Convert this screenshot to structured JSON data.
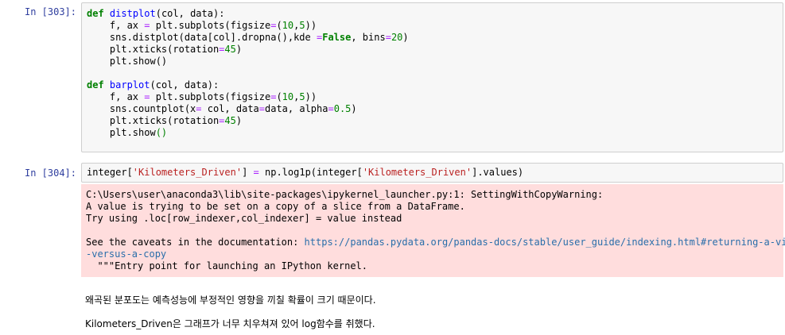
{
  "cell1": {
    "prompt": "In [303]:",
    "lines": [
      [
        [
          "kw",
          "def"
        ],
        [
          "t",
          " "
        ],
        [
          "fn",
          "distplot"
        ],
        [
          "t",
          "(col, data):"
        ]
      ],
      [
        [
          "t",
          "    f, ax "
        ],
        [
          "op",
          "="
        ],
        [
          "t",
          " plt.subplots(figsize"
        ],
        [
          "op",
          "="
        ],
        [
          "t",
          "("
        ],
        [
          "num",
          "10"
        ],
        [
          "t",
          ","
        ],
        [
          "num",
          "5"
        ],
        [
          "t",
          "))"
        ]
      ],
      [
        [
          "t",
          "    sns.distplot(data[col].dropna(),kde "
        ],
        [
          "op",
          "="
        ],
        [
          "kw",
          "False"
        ],
        [
          "t",
          ", bins"
        ],
        [
          "op",
          "="
        ],
        [
          "num",
          "20"
        ],
        [
          "t",
          ")"
        ]
      ],
      [
        [
          "t",
          "    plt.xticks(rotation"
        ],
        [
          "op",
          "="
        ],
        [
          "num",
          "45"
        ],
        [
          "t",
          ")"
        ]
      ],
      [
        [
          "t",
          "    plt.show()"
        ]
      ],
      [
        [
          "t",
          ""
        ]
      ],
      [
        [
          "kw",
          "def"
        ],
        [
          "t",
          " "
        ],
        [
          "fn",
          "barplot"
        ],
        [
          "t",
          "(col, data):"
        ]
      ],
      [
        [
          "t",
          "    f, ax "
        ],
        [
          "op",
          "="
        ],
        [
          "t",
          " plt.subplots(figsize"
        ],
        [
          "op",
          "="
        ],
        [
          "t",
          "("
        ],
        [
          "num",
          "10"
        ],
        [
          "t",
          ","
        ],
        [
          "num",
          "5"
        ],
        [
          "t",
          "))"
        ]
      ],
      [
        [
          "t",
          "    sns.countplot(x"
        ],
        [
          "op",
          "="
        ],
        [
          "t",
          " col, data"
        ],
        [
          "op",
          "="
        ],
        [
          "t",
          "data, alpha"
        ],
        [
          "op",
          "="
        ],
        [
          "num",
          "0.5"
        ],
        [
          "t",
          ")"
        ]
      ],
      [
        [
          "t",
          "    plt.xticks(rotation"
        ],
        [
          "op",
          "="
        ],
        [
          "num",
          "45"
        ],
        [
          "t",
          ")"
        ]
      ],
      [
        [
          "t",
          "    plt.show"
        ],
        [
          "num",
          "()"
        ]
      ]
    ]
  },
  "cell2": {
    "prompt": "In [304]:",
    "line": [
      [
        "t",
        "integer["
      ],
      [
        "str",
        "'Kilometers_Driven'"
      ],
      [
        "t",
        "] "
      ],
      [
        "op",
        "="
      ],
      [
        "t",
        " np.log1p(integer["
      ],
      [
        "str",
        "'Kilometers_Driven'"
      ],
      [
        "t",
        "].values)"
      ]
    ]
  },
  "warning": {
    "lines": [
      "C:\\Users\\user\\anaconda3\\lib\\site-packages\\ipykernel_launcher.py:1: SettingWithCopyWarning:",
      "A value is trying to be set on a copy of a slice from a DataFrame.",
      "Try using .loc[row_indexer,col_indexer] = value instead",
      "",
      "See the caveats in the documentation: ",
      "-versus-a-copy",
      "  \"\"\"Entry point for launching an IPython kernel."
    ],
    "link_part1": "https://pandas.pydata.org/pandas-docs/stable/user_guide/indexing.html#returning-a-view",
    "link_part2": "-versus-a-copy"
  },
  "markdown": {
    "p1": "왜곡된 분포도는 예측성능에 부정적인 영향을 끼칠 확률이 크기 때문이다.",
    "p2": "Kilometers_Driven은 그래프가 너무 치우쳐져 있어 log함수를 취했다."
  }
}
